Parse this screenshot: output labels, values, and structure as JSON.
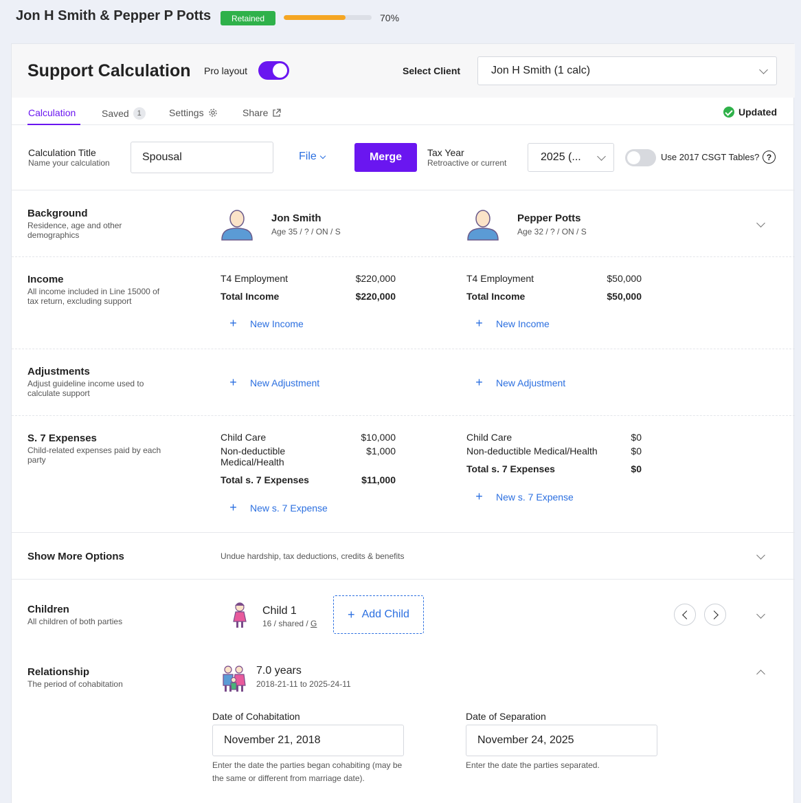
{
  "header": {
    "client_title": "Jon H Smith & Pepper P Potts",
    "status_badge": "Retained",
    "progress_percent": 70,
    "progress_text": "70%",
    "colors": {
      "accent": "#6a16f0",
      "link": "#2b6fe0",
      "badge": "#2fb14a",
      "progress": "#f5a623"
    }
  },
  "card": {
    "title": "Support Calculation",
    "pro_layout_label": "Pro layout",
    "pro_layout_on": true,
    "select_client_label": "Select Client",
    "select_client_value": "Jon H Smith (1 calc)"
  },
  "tabs": {
    "calculation": "Calculation",
    "saved": "Saved",
    "saved_count": "1",
    "settings": "Settings",
    "share": "Share",
    "updated": "Updated"
  },
  "calc": {
    "title_label": "Calculation Title",
    "title_sub": "Name your calculation",
    "title_value": "Spousal",
    "file_label": "File",
    "merge_label": "Merge",
    "tax_year_label": "Tax Year",
    "tax_year_sub": "Retroactive or current",
    "tax_year_value": "2025 (...",
    "csgt_label": "Use 2017 CSGT Tables?",
    "csgt_on": false,
    "help_glyph": "?"
  },
  "background": {
    "title": "Background",
    "sub": "Residence, age and other demographics",
    "party1_name": "Jon Smith",
    "party1_sub": "Age 35 / ? / ON / S",
    "party2_name": "Pepper Potts",
    "party2_sub": "Age 32 / ? / ON / S"
  },
  "income": {
    "title": "Income",
    "sub": "All income included in Line 15000 of tax return, excluding support",
    "party1": {
      "item_label": "T4 Employment",
      "item_value": "$220,000",
      "total_label": "Total Income",
      "total_value": "$220,000"
    },
    "party2": {
      "item_label": "T4 Employment",
      "item_value": "$50,000",
      "total_label": "Total Income",
      "total_value": "$50,000"
    },
    "new_label": "New Income"
  },
  "adjustments": {
    "title": "Adjustments",
    "sub": "Adjust guideline income used to calculate support",
    "new_label": "New Adjustment"
  },
  "expenses": {
    "title": "S. 7 Expenses",
    "sub": "Child-related expenses paid by each party",
    "party1": {
      "childcare_label": "Child Care",
      "childcare_value": "$10,000",
      "medical_label_1": "Non-deductible",
      "medical_label_2": "Medical/Health",
      "medical_value": "$1,000",
      "total_label": "Total s. 7 Expenses",
      "total_value": "$11,000"
    },
    "party2": {
      "childcare_label": "Child Care",
      "childcare_value": "$0",
      "medical_label": "Non-deductible Medical/Health",
      "medical_value": "$0",
      "total_label": "Total s. 7 Expenses",
      "total_value": "$0"
    },
    "new_label": "New s. 7 Expense"
  },
  "more_options": {
    "title": "Show More Options",
    "description": "Undue hardship, tax deductions, credits & benefits"
  },
  "children": {
    "title": "Children",
    "sub": "All children of both parties",
    "child_name": "Child 1",
    "child_sub": "16 / shared / ",
    "child_gender": "G",
    "add_label": "Add Child"
  },
  "relationship": {
    "title": "Relationship",
    "sub": "The period of cohabitation",
    "duration": "7.0 years",
    "range": "2018-21-11 to 2025-24-11",
    "cohab_label": "Date of Cohabitation",
    "cohab_value": "November 21, 2018",
    "cohab_help": "Enter the date the parties began cohabiting (may be the same or different from marriage date).",
    "sep_label": "Date of Separation",
    "sep_value": "November 24, 2025",
    "sep_help": "Enter the date the parties separated."
  }
}
